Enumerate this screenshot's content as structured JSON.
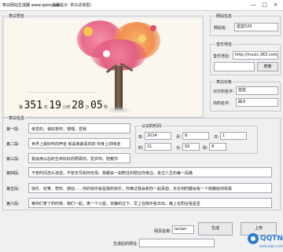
{
  "window": {
    "title": "表白网站生成器 www.qqtn.com",
    "hint": "(温馨提示: 表白请慎重)",
    "minimize": "—",
    "maximize": "□",
    "close": "×"
  },
  "preview": {
    "group_label": "表白预览",
    "line_text": "......................................................",
    "counter": {
      "prefix": "第",
      "days": "351",
      "day_label": "天",
      "hours": "19",
      "hour_label": "小时",
      "minutes": "28",
      "minute_label": "分",
      "seconds": "05",
      "second_label": "秒"
    }
  },
  "site_info": {
    "group_label": "网站信息",
    "name_label": "网站名:",
    "name_value": "蓝蓝520"
  },
  "music": {
    "group_label": "音乐地址",
    "url_label": "音乐地址:",
    "url_value": "http://music.363.com/outchain/player?",
    "search_label": "搜索"
  },
  "partners": {
    "group_label": "表白对象",
    "his_label": "对方的名字:",
    "his_value": "蓝蓝",
    "your_label": "你的名字:",
    "your_value": "曲子"
  },
  "paragraphs": {
    "group_label": "表白信息",
    "items": [
      {
        "label": "第一段:",
        "text": "亲爱的，我好想你，嘿嘿，爱我"
      },
      {
        "label": "第二段:",
        "text": "世界上最好听的声音 就是我最喜欢的 你身上的味道"
      },
      {
        "label": "第三段:",
        "text": "我会用以后的生命好好的照顾你，爱护你，陪着你"
      },
      {
        "label": "第四段:",
        "text": "不管时间怎么流逝，不管岁月如何无情，我都会一如既往的陪在你身边，走过人生的每一段路"
      },
      {
        "label": "第五段:",
        "text": "快乐、欢笑、悲伤、感动……你的快乐就是我的快乐，你难过我会和你一起承担，无论何时都会有一个肩膀给你依靠"
      },
      {
        "label": "第六段:",
        "text": "等你们老了的时候，我们一起，携一个小屋，安静的过下，早上在院中看日出，晚上在阳台看星星"
      }
    ]
  },
  "time_settings": {
    "group_label": "认识的时间",
    "year_label": "年:",
    "year_value": "2014",
    "month_label": "月:",
    "month_value": "8",
    "day_label": "日:",
    "day_value": "1",
    "hour_label": "时:",
    "hour_value": "21",
    "minute_label": "分:",
    "minute_value": "50",
    "second_label": "秒:",
    "second_value": "8"
  },
  "bottom": {
    "filename_label": "网页名称:",
    "filename_value": "lanlan",
    "generate_label": "生成",
    "upload_label": "上传",
    "link_label": "生成后的网址:",
    "link_value": ""
  },
  "watermark": {
    "text": "QQTN",
    "subtext": "www.qqtn.com"
  },
  "colors": {
    "title_bar": "#ffffff",
    "window_bg": "#f0f0f0",
    "preview_bg": "#fbf7ee",
    "heart_pink": "#e86a8a",
    "heart_orange": "#f0a04a",
    "input_border": "#9ea7b0",
    "watermark_blue": "#2a7fd4"
  }
}
